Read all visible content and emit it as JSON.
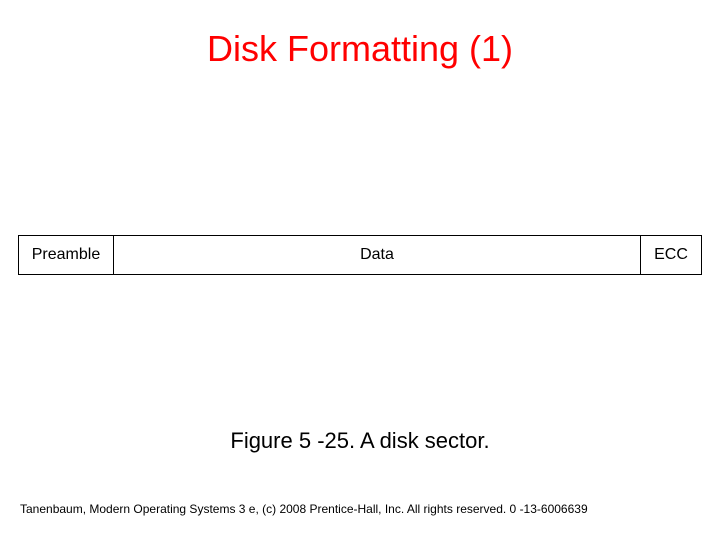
{
  "title": {
    "text": "Disk Formatting (1)",
    "color": "#ff0000"
  },
  "diagram": {
    "cells": [
      {
        "label": "Preamble"
      },
      {
        "label": "Data"
      },
      {
        "label": "ECC"
      }
    ]
  },
  "caption": "Figure 5 -25. A disk sector.",
  "footer": "Tanenbaum, Modern Operating Systems 3 e, (c) 2008 Prentice-Hall, Inc. All rights reserved. 0 -13-6006639"
}
